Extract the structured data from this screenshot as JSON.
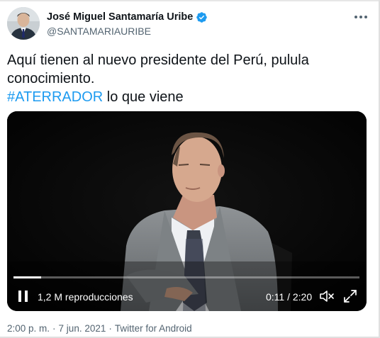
{
  "author": {
    "display_name": "José Miguel Santamaría Uribe",
    "handle": "@SANTAMARIAURIBE",
    "verified": true
  },
  "tweet": {
    "text_line1": "Aquí tienen al nuevo presidente del Perú, pulula",
    "text_line2": "conocimiento.",
    "hashtag": "#ATERRADOR",
    "text_line3_rest": " lo que viene"
  },
  "video": {
    "views": "1,2 M reproducciones",
    "time": "0:11 / 2:20",
    "progress_fraction": 0.08
  },
  "meta": {
    "time": "2:00 p. m.",
    "separator1": "·",
    "date": "7 jun. 2021",
    "separator2": "·",
    "source": "Twitter for Android"
  },
  "colors": {
    "link": "#1d9bf0",
    "text": "#0f1419",
    "secondary": "#536471",
    "verified": "#1d9bf0"
  },
  "icons": {
    "verified": "verified-badge-icon",
    "more": "more-dots-icon",
    "pause": "pause-icon",
    "mute": "mute-icon",
    "fullscreen": "fullscreen-icon"
  }
}
